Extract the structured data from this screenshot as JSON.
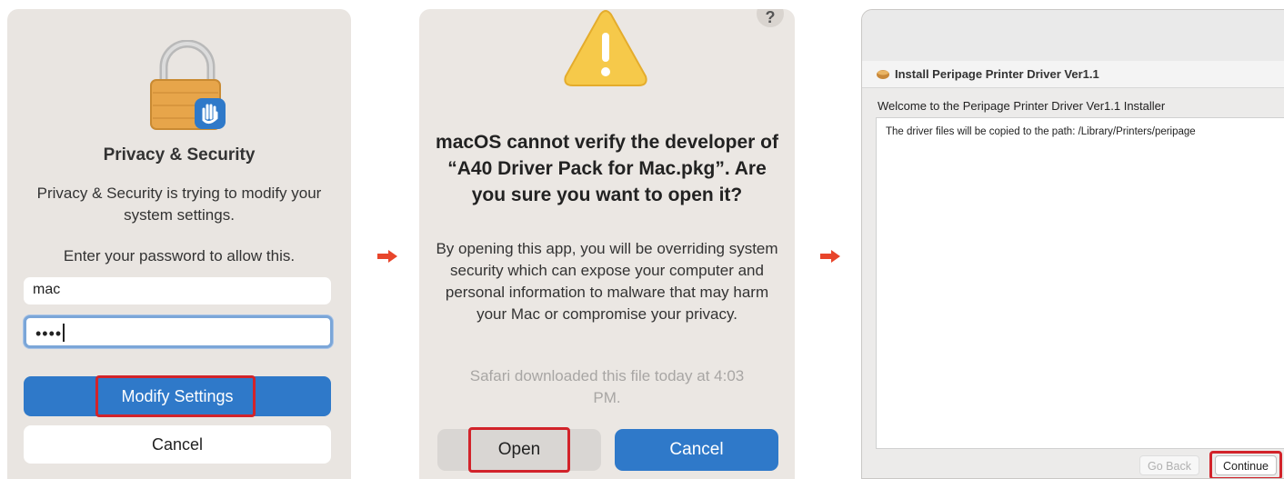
{
  "colors": {
    "accent_blue": "#2f79c9",
    "highlight_red": "#d2232a",
    "arrow_red": "#e8452b",
    "warning_yellow": "#f6c94a",
    "lock_orange": "#e7a54a"
  },
  "step1": {
    "icon": "lock-icon",
    "title": "Privacy & Security",
    "subtitle": "Privacy & Security is trying to modify your system settings.",
    "prompt": "Enter your password to allow this.",
    "username_value": "mac",
    "password_value": "••••",
    "primary_button": "Modify Settings",
    "secondary_button": "Cancel"
  },
  "step2": {
    "help": "?",
    "icon": "warning-icon",
    "title": "macOS cannot verify the developer of “A40 Driver Pack for Mac.pkg”. Are you sure you want to open it?",
    "body": "By opening this app, you will be overriding system security which can expose your computer and personal information to malware that may harm your Mac or compromise your privacy.",
    "note": "Safari downloaded this file today at 4:03 PM.",
    "open_button": "Open",
    "cancel_button": "Cancel"
  },
  "step3": {
    "window_title": "Install Peripage Printer Driver Ver1.1",
    "welcome": "Welcome to the Peripage Printer Driver Ver1.1 Installer",
    "content_text": "The driver files will be copied to the path: /Library/Printers/peripage",
    "back_button": "Go Back",
    "continue_button": "Continue"
  }
}
